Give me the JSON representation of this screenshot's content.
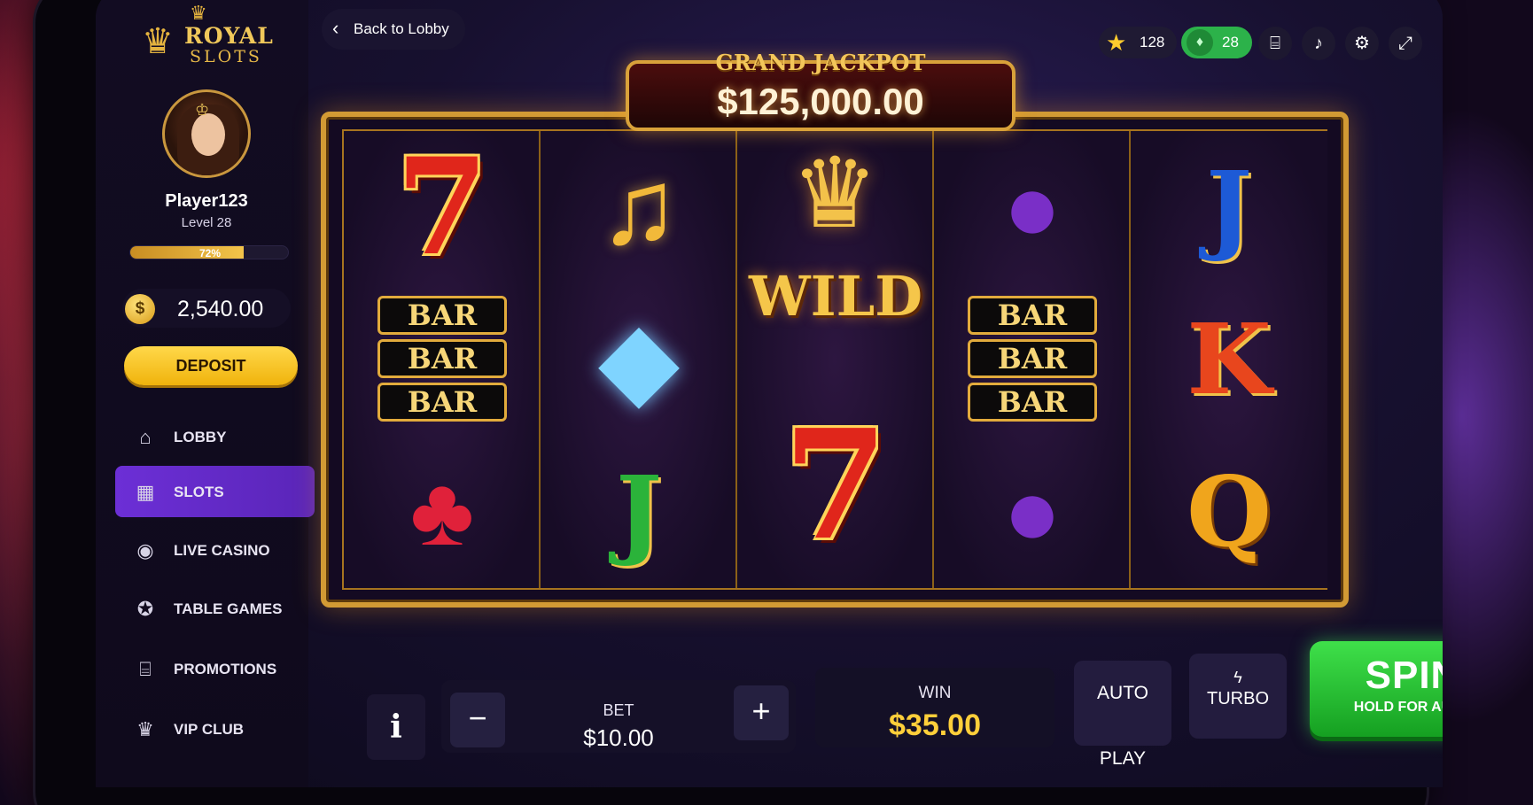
{
  "brand": {
    "line1": "ROYAL",
    "line2": "SLOTS"
  },
  "player": {
    "name": "Player123",
    "level": "Level 28",
    "xp_percent": 72,
    "xp_label": "72%"
  },
  "wallet": {
    "coin_symbol": "$",
    "balance": "2,540.00",
    "deposit_label": "DEPOSIT"
  },
  "nav": [
    {
      "label": "LOBBY",
      "icon": "home-icon",
      "active": false
    },
    {
      "label": "SLOTS",
      "icon": "slots-icon",
      "active": true
    },
    {
      "label": "LIVE CASINO",
      "icon": "live-casino-icon",
      "active": false
    },
    {
      "label": "TABLE GAMES",
      "icon": "chip-icon",
      "active": false
    },
    {
      "label": "PROMOTIONS",
      "icon": "gift-icon",
      "active": false
    },
    {
      "label": "VIP CLUB",
      "icon": "crown-icon",
      "active": false
    }
  ],
  "topbar": {
    "back_label": "Back to Lobby",
    "stars": "128",
    "gems": "28",
    "icons": [
      "gift-icon",
      "bell-icon",
      "gear-icon",
      "fullscreen-icon"
    ]
  },
  "jackpot": {
    "title": "GRAND JACKPOT",
    "amount": "$125,000.00"
  },
  "reels": [
    [
      "seven",
      "bar",
      "cherry"
    ],
    [
      "bell",
      "diamond",
      "J"
    ],
    [
      "wild",
      "seven"
    ],
    [
      "plum",
      "bar",
      "plum"
    ],
    [
      "J",
      "K",
      "Q"
    ]
  ],
  "symbols": {
    "bar_text": "BAR",
    "wild_text": "WILD",
    "seven_text": "7"
  },
  "controls": {
    "info_label": "i",
    "minus_label": "−",
    "plus_label": "+",
    "bet_label": "BET",
    "bet_value": "$10.00",
    "win_label": "WIN",
    "win_value": "$35.00",
    "auto_line1": "AUTO",
    "auto_line2": "PLAY",
    "turbo_label": "TURBO",
    "spin_label": "SPIN",
    "spin_sub": "HOLD FOR AUTO"
  },
  "colors": {
    "accent_gold": "#d29a34",
    "active_nav": "#6c2fd6",
    "spin_green": "#2cc23a",
    "win_yellow": "#ffcf3a"
  }
}
